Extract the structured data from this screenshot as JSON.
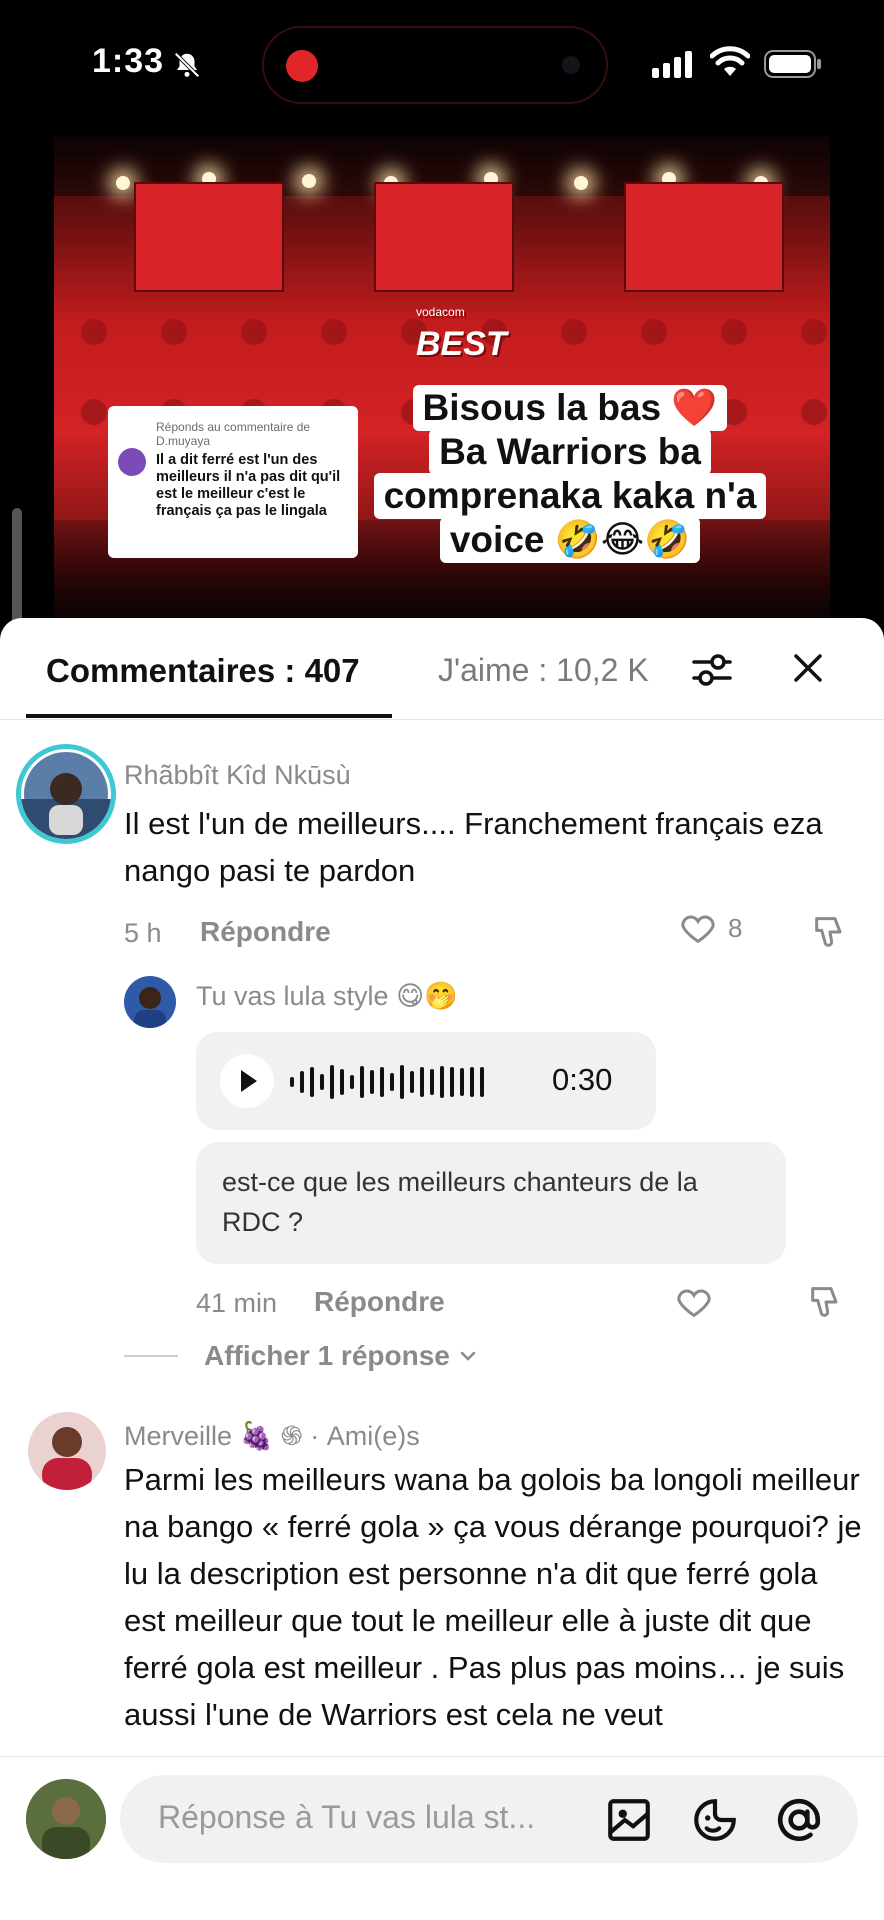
{
  "status_bar": {
    "time": "1:33",
    "icons": [
      "bell-off-icon",
      "recording-indicator",
      "signal-icon",
      "wifi-icon",
      "battery-icon"
    ]
  },
  "video": {
    "logo_text": "BEST",
    "logo_sub": "vodacom",
    "reply_sticker": {
      "header": "Réponds au commentaire de D.muyaya",
      "body": "Il a dit ferré est l'un des meilleurs il n'a pas dit qu'il est le meilleur c'est le français ça pas le lingala"
    },
    "caption_lines": [
      "Bisous la bas ❤️",
      "Ba Warriors ba",
      "comprenaka kaka n'a",
      "voice 🤣😂🤣"
    ]
  },
  "tabs": {
    "comments": "Commentaires : 407",
    "likes": "J'aime : 10,2 K"
  },
  "comments": [
    {
      "username": "Rhãbbît Kîd Nkūsù",
      "text": "Il est l'un de meilleurs.... Franchement français eza nango pasi te pardon",
      "time": "5 h",
      "reply_label": "Répondre",
      "likes": "8"
    },
    {
      "username": "Tu vas lula style 😋🤭",
      "voice_duration": "0:30",
      "transcript": "est-ce que les meilleurs chanteurs de la RDC ?",
      "time": "41 min",
      "reply_label": "Répondre",
      "view_replies": "Afficher 1 réponse"
    },
    {
      "username": "Merveille 🍇 ֍",
      "tag": " · Ami(e)s",
      "text": "Parmi les meilleurs wana ba golois ba longoli meilleur na bango « ferré gola » ça vous dérange pourquoi? je lu la description est personne n'a dit que ferré gola est meilleur que tout le meilleur elle à juste dit que ferré gola est meilleur . Pas plus pas moins… je suis aussi l'une de Warriors est cela ne veut"
    }
  ],
  "input": {
    "placeholder": "Réponse à Tu vas lula st..."
  },
  "colors": {
    "video_red": "#d32325",
    "record_red": "#e0262b",
    "text_dark": "#111111",
    "text_muted": "#8a8a8a"
  }
}
